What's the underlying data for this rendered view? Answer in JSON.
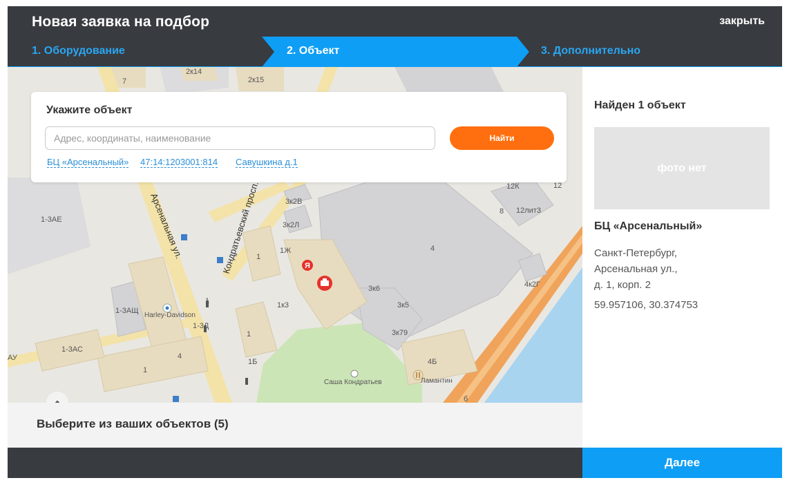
{
  "header": {
    "title": "Новая заявка на подбор",
    "close_label": "закрыть"
  },
  "steps": [
    {
      "label": "1. Оборудование",
      "state": "done"
    },
    {
      "label": "2. Объект",
      "state": "active"
    },
    {
      "label": "3. Дополнительно",
      "state": "upcoming"
    }
  ],
  "search": {
    "title": "Укажите объект",
    "placeholder": "Адрес, координаты, наименование",
    "value": "",
    "button_label": "Найти",
    "quick_links": [
      "БЦ «Арсенальный»",
      "47:14:1203001:814",
      "Савушкина д.1"
    ]
  },
  "map": {
    "labels": {
      "b2k14": "2к14",
      "b2k15": "2к15",
      "b7": "7",
      "b1zae": "1-3АЕ",
      "b3k2v": "3к2В",
      "b3k2l": "3к2Л",
      "b1zh": "1Ж",
      "b1a": "1",
      "b4a": "4",
      "b12k": "12К",
      "b12": "12",
      "b8": "8",
      "b12lit3": "12лит3",
      "b4k2g": "4к2Г",
      "b3k6": "3к6",
      "b3k5": "3к5",
      "b3k79": "3к79",
      "b1k3": "1к3",
      "b1zashch": "1-3АЩ",
      "harley": "Harley-Davidson",
      "b1zd": "1-3Д",
      "b1zas": "1-3АС",
      "b4b": "4",
      "b1b": "1",
      "b1c": "1",
      "b1d": "1",
      "b1bb": "1Б",
      "b4bb": "4Б",
      "lamantin": "Ламантин",
      "sasha": "Саша Кондратьев",
      "au": "АУ",
      "b6": "б"
    },
    "streets": {
      "arsenalnaya": "Арсенальная ул.",
      "kondratyevsky": "Кондратьевский просп."
    },
    "colors": {
      "land": "#e9e7e2",
      "building": "#d3d3d5",
      "building_beige": "#e8dcc0",
      "road": "#f3e3a9",
      "water": "#a8d4ef",
      "park": "#cce5b7",
      "highway": "#f0a35a"
    }
  },
  "objects_bar": {
    "label": "Выберите из ваших объектов (5)"
  },
  "result": {
    "found_title": "Найден 1 объект",
    "photo_placeholder": "фото нет",
    "name": "БЦ «Арсенальный»",
    "address_lines": [
      "Санкт-Петербург,",
      "Арсенальная  ул.,",
      "д. 1, корп. 2"
    ],
    "coordinates": "59.957106, 30.374753"
  },
  "footer": {
    "next_label": "Далее"
  },
  "colors": {
    "header_bg": "#383b40",
    "accent_blue": "#0f9ef5",
    "accent_orange": "#ff6f0f"
  }
}
